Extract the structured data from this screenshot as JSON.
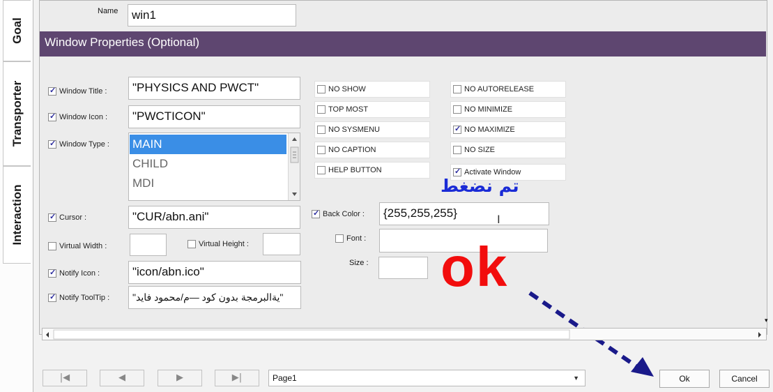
{
  "tabs": [
    "Goal",
    "Transporter",
    "Interaction"
  ],
  "name": {
    "label": "Name",
    "value": "win1"
  },
  "section_title": "Window Properties (Optional)",
  "fields": {
    "window_title": {
      "label": "Window Title :",
      "value": "\"PHYSICS AND PWCT\"",
      "checked": true
    },
    "window_icon": {
      "label": "Window Icon :",
      "value": "\"PWCTICON\"",
      "checked": true
    },
    "window_type": {
      "label": "Window Type :",
      "checked": true,
      "options": [
        "MAIN",
        "CHILD",
        "MDI"
      ],
      "selected": "MAIN"
    },
    "cursor": {
      "label": "Cursor :",
      "value": "\"CUR/abn.ani\"",
      "checked": true
    },
    "virtual_width": {
      "label": "Virtual Width :",
      "value": "",
      "checked": false
    },
    "virtual_height": {
      "label": "Virtual Height :",
      "value": "",
      "checked": false
    },
    "notify_icon": {
      "label": "Notify Icon :",
      "value": "\"icon/abn.ico\"",
      "checked": true
    },
    "notify_tooltip": {
      "label": "Notify ToolTip :",
      "value": "\"يةالبرمجة بدون كود —م/محمود فايد\"",
      "checked": true
    }
  },
  "options_left": [
    {
      "label": "NO SHOW",
      "checked": false
    },
    {
      "label": "TOP MOST",
      "checked": false
    },
    {
      "label": "NO SYSMENU",
      "checked": false
    },
    {
      "label": "NO CAPTION",
      "checked": false
    },
    {
      "label": "HELP BUTTON",
      "checked": false
    }
  ],
  "options_right": [
    {
      "label": "NO AUTORELEASE",
      "checked": false
    },
    {
      "label": "NO MINIMIZE",
      "checked": false
    },
    {
      "label": "NO MAXIMIZE",
      "checked": true
    },
    {
      "label": "NO SIZE",
      "checked": false
    },
    {
      "label": "Activate Window",
      "checked": true
    }
  ],
  "back_color": {
    "label": "Back Color :",
    "value": "{255,255,255}",
    "checked": true
  },
  "font": {
    "label": "Font :",
    "value": "",
    "checked": false
  },
  "size": {
    "label": "Size :",
    "value": ""
  },
  "annotations": {
    "arabic": "تم نضغط",
    "ok": "ok"
  },
  "nav": {
    "buttons": [
      "first-page-icon",
      "prev-page-icon",
      "next-page-icon",
      "last-page-icon"
    ],
    "page_select": "Page1",
    "ok_label": "Ok",
    "cancel_label": "Cancel"
  },
  "colors": {
    "header_bar": "#5e4670",
    "annotation_red": "#f20d0d",
    "annotation_blue": "#1a2bd6",
    "selection": "#3a8ee6"
  }
}
